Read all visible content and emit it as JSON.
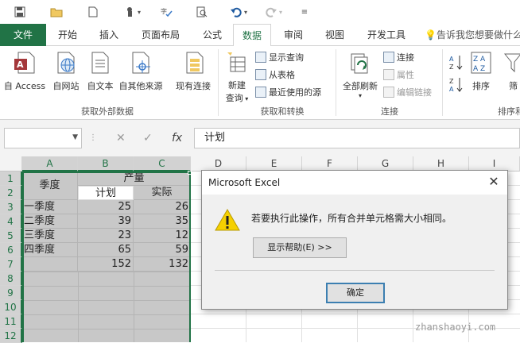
{
  "tabs": [
    "文件",
    "开始",
    "插入",
    "页面布局",
    "公式",
    "数据",
    "审阅",
    "视图",
    "开发工具"
  ],
  "tell_me": "告诉我您想要做什么...",
  "ribbon": {
    "get_external": {
      "buttons": [
        "自 Access",
        "自网站",
        "自文本",
        "自其他来源",
        "现有连接"
      ],
      "label": "获取外部数据"
    },
    "transform": {
      "new_query": "新建\n查询",
      "new_query_top": "新建",
      "new_query_bottom": "查询",
      "show_queries": "显示查询",
      "from_table": "从表格",
      "recent_sources": "最近使用的源",
      "label": "获取和转换"
    },
    "connections": {
      "refresh_all": "全部刷新",
      "connections": "连接",
      "properties": "属性",
      "edit_links": "编辑链接",
      "label": "连接"
    },
    "sort": {
      "sort": "排序",
      "filter": "筛",
      "label": "排序和"
    }
  },
  "formula_bar": {
    "name_box": "",
    "fx": "fx",
    "content": "计划"
  },
  "grid": {
    "columns": [
      "A",
      "B",
      "C",
      "D",
      "E",
      "F",
      "G",
      "H",
      "I"
    ],
    "rows": [
      "1",
      "2",
      "3",
      "4",
      "5",
      "6",
      "7",
      "8",
      "9",
      "10",
      "11",
      "12"
    ],
    "header_season": "季度",
    "header_output": "产量",
    "header_plan": "计划",
    "header_actual": "实际",
    "data": [
      {
        "q": "一季度",
        "plan": "25",
        "actual": "26"
      },
      {
        "q": "二季度",
        "plan": "39",
        "actual": "35"
      },
      {
        "q": "三季度",
        "plan": "23",
        "actual": "12"
      },
      {
        "q": "四季度",
        "plan": "65",
        "actual": "59"
      }
    ],
    "total_plan": "152",
    "total_actual": "132"
  },
  "dialog": {
    "title": "Microsoft Excel",
    "message": "若要执行此操作，所有合并单元格需大小相同。",
    "help_button": "显示帮助(E) >>",
    "ok_button": "确定"
  },
  "watermark": "zhanshaoyi.com",
  "colors": {
    "excel_green": "#217346",
    "selection_gray": "#c8c8c8",
    "warning_yellow": "#f5d000"
  }
}
